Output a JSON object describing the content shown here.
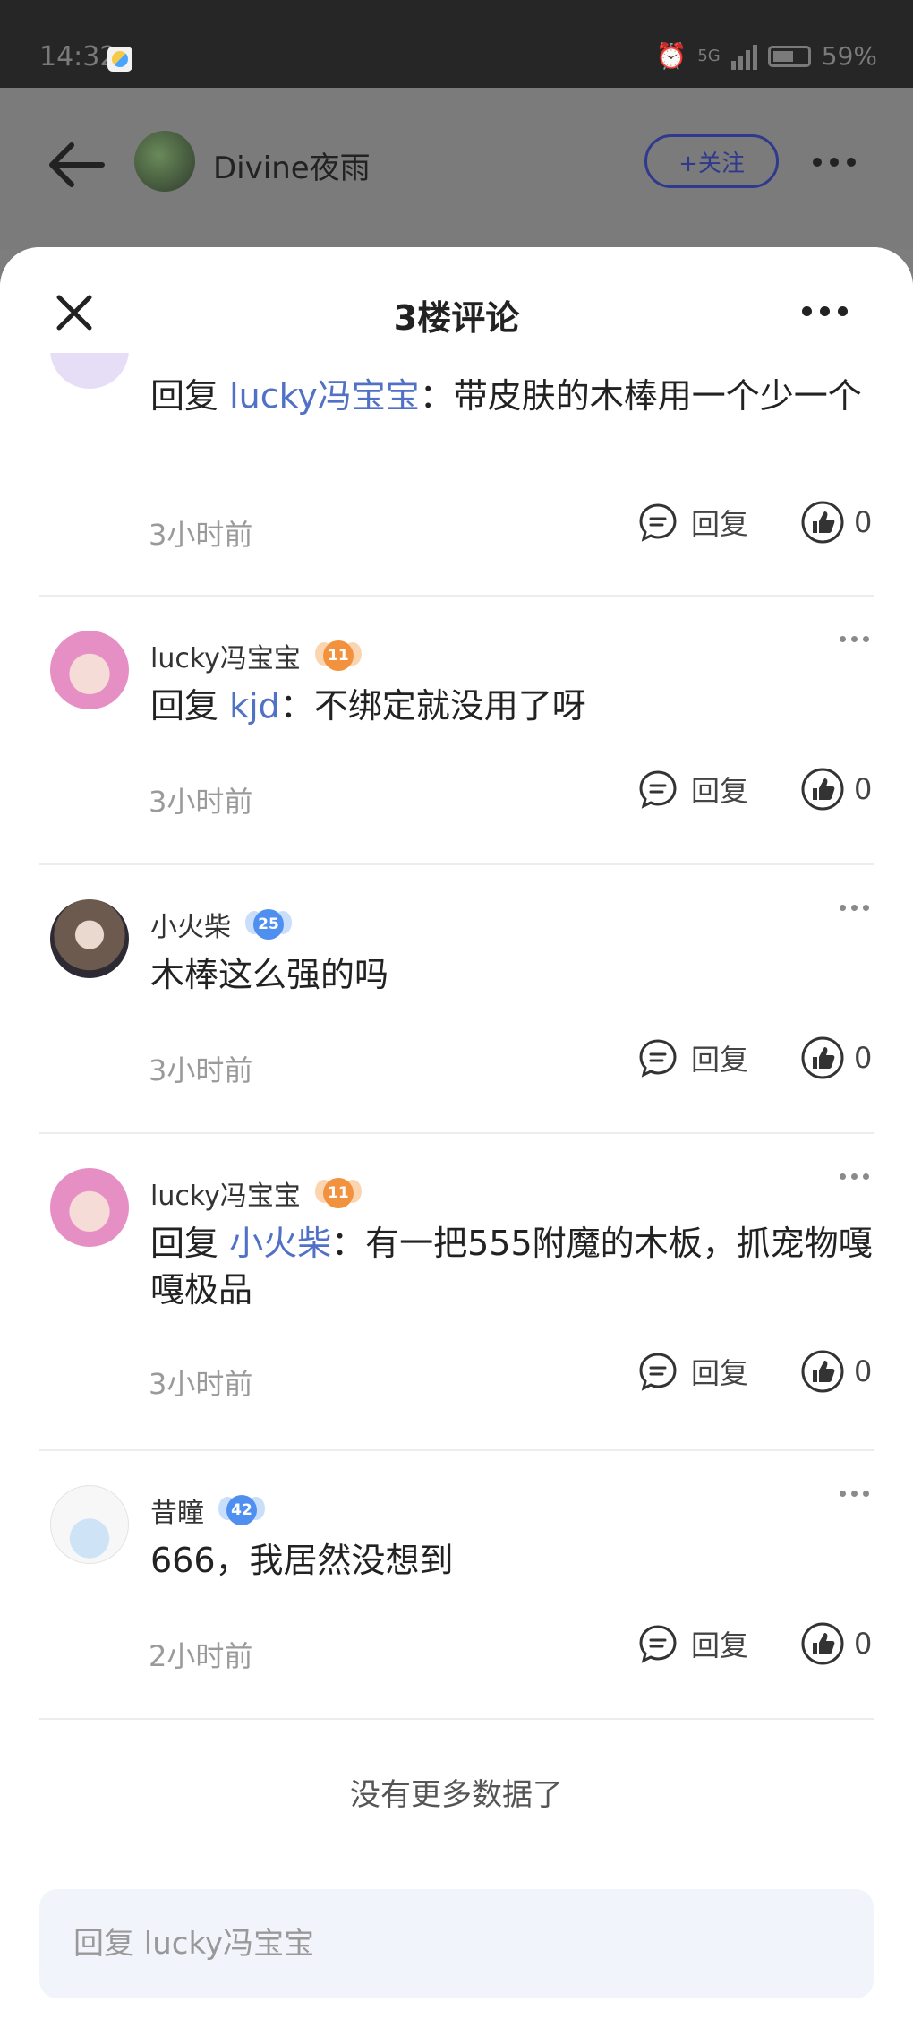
{
  "status_bar": {
    "time": "14:32",
    "network": "5G",
    "battery": "59%"
  },
  "header": {
    "author_name": "Divine夜雨",
    "follow_label": "+关注"
  },
  "sheet": {
    "title": "3楼评论"
  },
  "comments": [
    {
      "user": "",
      "reply_prefix": "回复",
      "mention": "lucky冯宝宝",
      "text": "：带皮肤的木棒用一个少一个",
      "time": "3小时前",
      "reply_label": "回复",
      "likes": "0"
    },
    {
      "user": "lucky冯宝宝",
      "level": "11",
      "reply_prefix": "回复",
      "mention": "kjd",
      "text": "：不绑定就没用了呀",
      "time": "3小时前",
      "reply_label": "回复",
      "likes": "0"
    },
    {
      "user": "小火柴",
      "level": "25",
      "text": "木棒这么强的吗",
      "time": "3小时前",
      "reply_label": "回复",
      "likes": "0"
    },
    {
      "user": "lucky冯宝宝",
      "level": "11",
      "reply_prefix": "回复",
      "mention": "小火柴",
      "text": "：有一把555附魔的木板，抓宠物嘎嘎极品",
      "time": "3小时前",
      "reply_label": "回复",
      "likes": "0"
    },
    {
      "user": "昔瞳",
      "level": "42",
      "text": "666，我居然没想到",
      "time": "2小时前",
      "reply_label": "回复",
      "likes": "0"
    }
  ],
  "no_more_text": "没有更多数据了",
  "reply_input": {
    "placeholder": "回复 lucky冯宝宝"
  },
  "colors": {
    "accent": "#2f3a8c",
    "mention": "#5071c6",
    "badge_orange": "#f3923e",
    "badge_blue": "#4f8ff0"
  }
}
